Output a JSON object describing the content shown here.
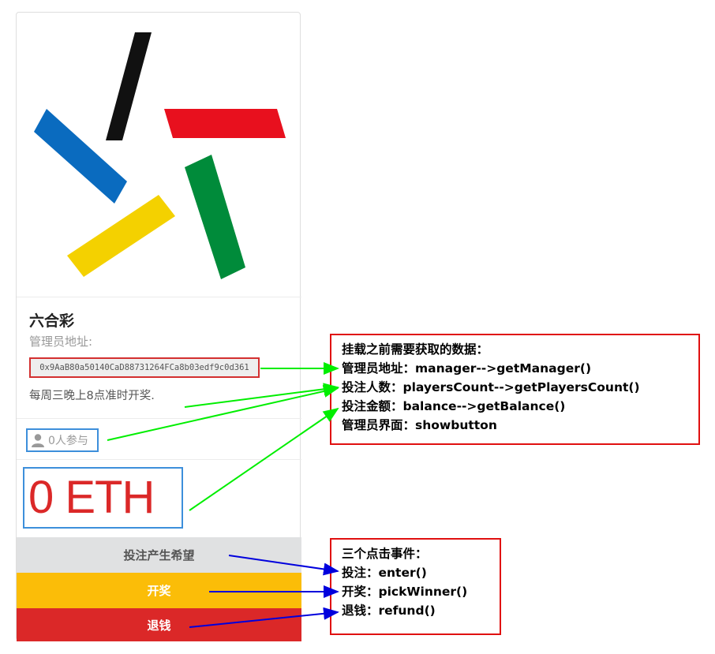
{
  "lottery": {
    "title": "六合彩",
    "manager_label": "管理员地址:",
    "manager_address": "0x9AaB80a50140CaD88731264FCa8b03edf9c0d361",
    "schedule": "每周三晚上8点准时开奖.",
    "players_text": "0人参与",
    "balance_text": "0 ETH",
    "logo_colors": [
      "#111111",
      "#e8101e",
      "#0a6bbf",
      "#f4d100",
      "#008b3a"
    ]
  },
  "buttons": {
    "enter_label": "投注产生希望",
    "pick_label": "开奖",
    "refund_label": "退钱"
  },
  "annotations": {
    "data_note": [
      "挂载之前需要获取的数据：",
      "管理员地址：manager-->getManager()",
      "投注人数：playersCount-->getPlayersCount()",
      "投注金额：balance-->getBalance()",
      "管理员界面：showbutton"
    ],
    "event_note": [
      "三个点击事件：",
      "投注：enter()",
      "开奖：pickWinner()",
      "退钱：refund()"
    ]
  },
  "colors": {
    "arrow_green": "#00ee00",
    "arrow_blue": "#0000dd",
    "note_border": "#e01010",
    "highlight_blue": "#3d8fdb"
  }
}
